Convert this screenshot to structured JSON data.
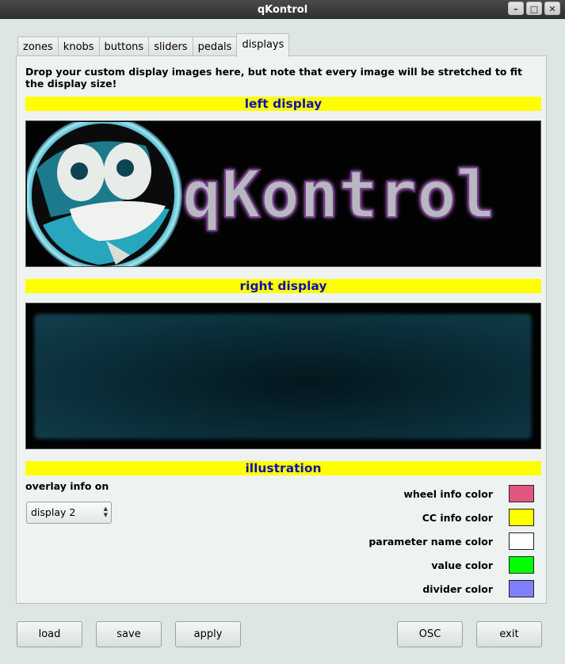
{
  "window": {
    "title": "qKontrol"
  },
  "tabs": [
    "zones",
    "knobs",
    "buttons",
    "sliders",
    "pedals",
    "displays"
  ],
  "active_tab": "displays",
  "intro_text": "Drop your custom display images here, but note that every image will be stretched to fit the display size!",
  "sections": {
    "left_display": "left display",
    "right_display": "right display",
    "illustration": "illustration"
  },
  "logo_text": "qKontrol",
  "overlay": {
    "label": "overlay info on",
    "selected": "display 2"
  },
  "colors": [
    {
      "label": "wheel info color",
      "hex": "#e15680"
    },
    {
      "label": "CC info color",
      "hex": "#ffff00"
    },
    {
      "label": "parameter name color",
      "hex": "#ffffff"
    },
    {
      "label": "value color",
      "hex": "#00ff00"
    },
    {
      "label": "divider color",
      "hex": "#8080ff"
    }
  ],
  "buttons": {
    "load": "load",
    "save": "save",
    "apply": "apply",
    "osc": "OSC",
    "exit": "exit"
  }
}
